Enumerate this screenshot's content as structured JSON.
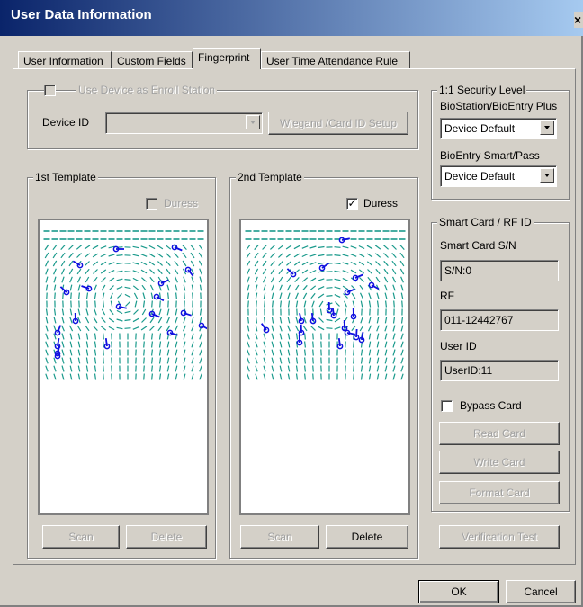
{
  "window": {
    "title": "User Data Information",
    "close_label": "×"
  },
  "tabs": [
    {
      "label": "User Information",
      "active": false
    },
    {
      "label": "Custom Fields",
      "active": false
    },
    {
      "label": "Fingerprint",
      "active": true
    },
    {
      "label": "User Time Attendance Rule",
      "active": false
    }
  ],
  "enroll": {
    "checkbox_label": "Use Device as Enroll Station",
    "checked": false,
    "device_id_label": "Device ID",
    "device_id_value": "",
    "wiegand_button": "Wiegand /Card ID Setup"
  },
  "template1": {
    "title": "1st Template",
    "duress_label": "Duress",
    "duress_checked": false,
    "scan_label": "Scan",
    "delete_label": "Delete"
  },
  "template2": {
    "title": "2nd Template",
    "duress_label": "Duress",
    "duress_checked": true,
    "scan_label": "Scan",
    "delete_label": "Delete"
  },
  "security": {
    "title": "1:1 Security Level",
    "biostation_label": "BioStation/BioEntry Plus",
    "biostation_value": "Device Default",
    "bioentry_label": "BioEntry Smart/Pass",
    "bioentry_value": "Device Default"
  },
  "card": {
    "title": "Smart Card / RF ID",
    "sn_label": "Smart Card S/N",
    "sn_value": "S/N:0",
    "rf_label": "RF",
    "rf_value": "011-12442767",
    "userid_label": "User ID",
    "userid_value": "UserID:11",
    "bypass_label": "Bypass Card",
    "bypass_checked": false,
    "read_label": "Read Card",
    "write_label": "Write Card",
    "format_label": "Format Card"
  },
  "verification_label": "Verification Test",
  "footer": {
    "ok_label": "OK",
    "cancel_label": "Cancel"
  },
  "colors": {
    "ridge": "#1a9a8c",
    "minutia": "#1010e0",
    "title_bar": "#0a246a"
  }
}
